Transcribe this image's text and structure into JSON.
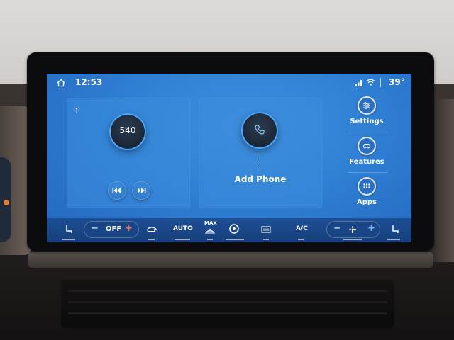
{
  "status_bar": {
    "time": "12:53",
    "temperature": "39°",
    "icons": [
      "home-icon",
      "cellular-signal-icon",
      "wifi-icon"
    ]
  },
  "radio_card": {
    "frequency": "540",
    "source_icon": "radio-broadcast-icon",
    "buttons": [
      "seek-previous-icon",
      "seek-next-icon"
    ]
  },
  "phone_card": {
    "label": "Add Phone",
    "icon": "phone-icon"
  },
  "side_menu": [
    {
      "label": "Settings",
      "icon": "sliders-icon"
    },
    {
      "label": "Features",
      "icon": "car-icon"
    },
    {
      "label": "Apps",
      "icon": "grid-icon"
    }
  ],
  "climate": {
    "driver_temp": "OFF",
    "auto_label": "AUTO",
    "max_label": "MAX",
    "ac_label": "A/C",
    "icons": [
      "heated-seat-icon",
      "recirculate-icon",
      "max-defrost-icon",
      "steering-wheel-heat-icon",
      "rear-defrost-icon",
      "fan-icon",
      "passenger-seat-icon"
    ]
  },
  "colors": {
    "screen_blue": "#2f7fd4",
    "accent_ring": "#4aa9ff",
    "plus_red": "#ff6b4a"
  }
}
